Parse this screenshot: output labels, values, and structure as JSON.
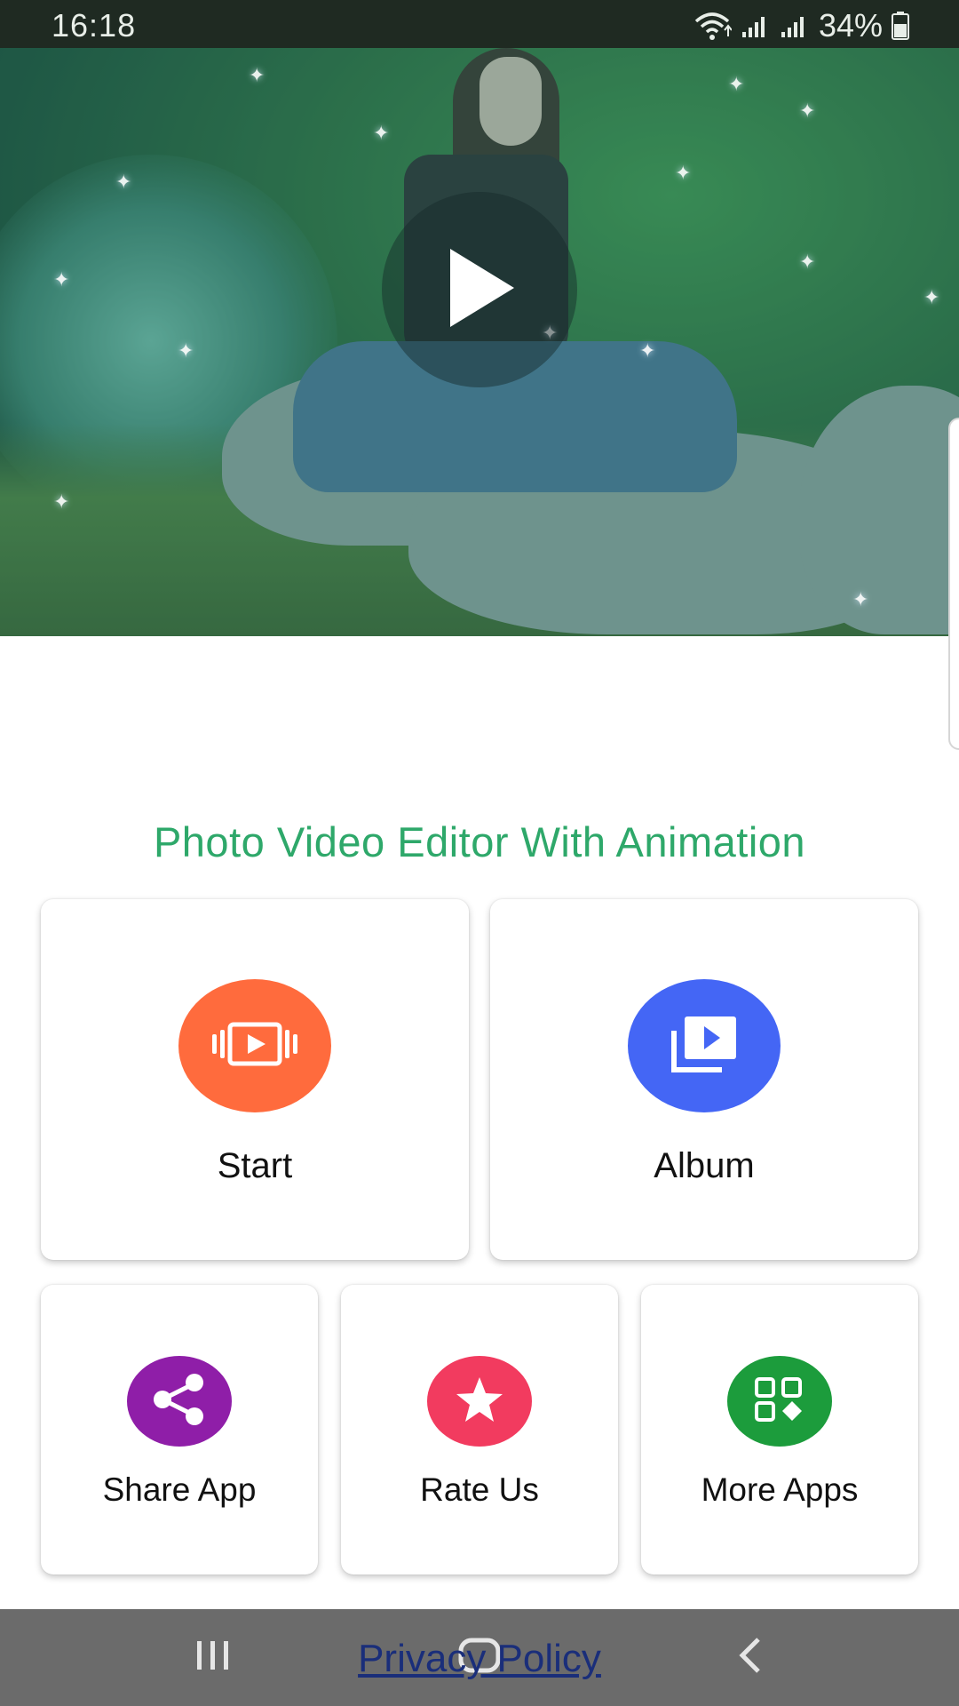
{
  "status_bar": {
    "time": "16:18",
    "battery_percent": "34%",
    "icons": [
      "wifi-icon",
      "signal-icon",
      "signal-icon",
      "battery-icon"
    ]
  },
  "hero": {
    "icon": "play-icon"
  },
  "app_title": "Photo Video Editor With Animation",
  "actions": {
    "start": {
      "label": "Start",
      "icon": "video-film-icon",
      "color": "#ff6b3d"
    },
    "album": {
      "label": "Album",
      "icon": "video-library-icon",
      "color": "#4466f5"
    },
    "share": {
      "label": "Share App",
      "icon": "share-icon",
      "color": "#8f1ea8"
    },
    "rate": {
      "label": "Rate Us",
      "icon": "star-icon",
      "color": "#f23b5f"
    },
    "more": {
      "label": "More Apps",
      "icon": "apps-grid-icon",
      "color": "#1c9c3c"
    }
  },
  "footer": {
    "privacy_link": "Privacy Policy"
  },
  "nav_bar": {
    "icons": [
      "recent-apps-icon",
      "home-icon",
      "back-icon"
    ],
    "color": "#6b6b6b"
  }
}
